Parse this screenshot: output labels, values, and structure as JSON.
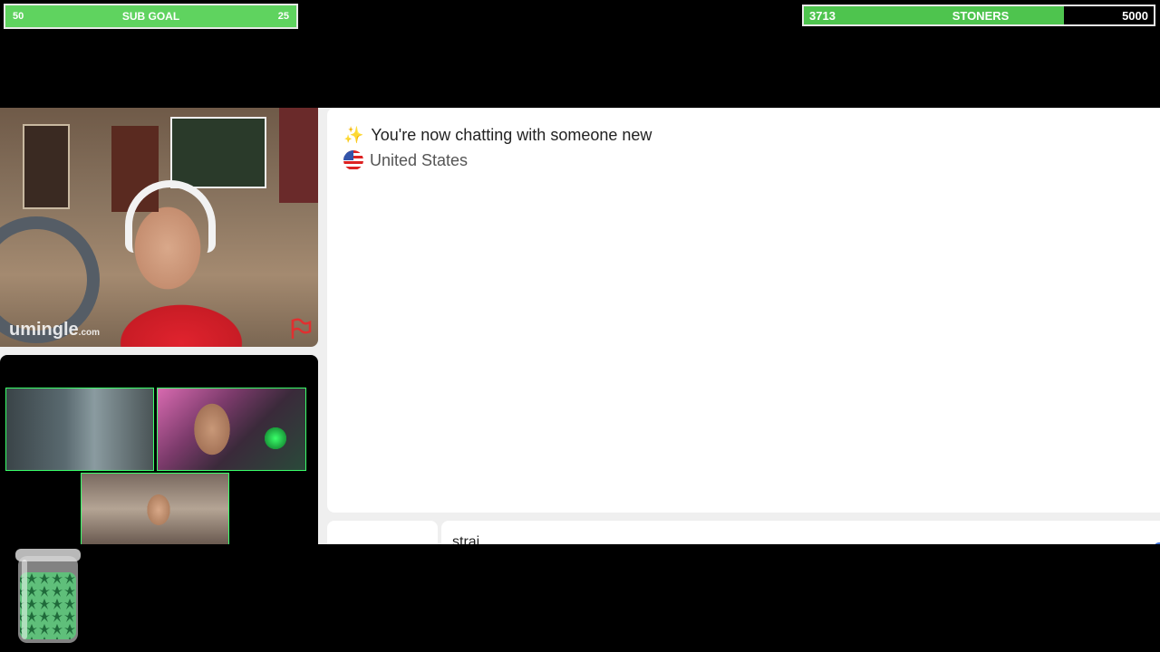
{
  "overlay": {
    "sub_goal": {
      "current": "50",
      "label": "SUB GOAL",
      "target": "25",
      "fill_fraction": 1.0,
      "color": "#5fd35f"
    },
    "stoners": {
      "current": "3713",
      "label": "STONERS",
      "target": "5000",
      "fill_fraction": 0.7426,
      "color": "#4ec44e"
    }
  },
  "video": {
    "main_logo": "umingle",
    "main_logo_suffix": ".com",
    "flag_icon": "report-flag-icon"
  },
  "chat": {
    "status_icon": "sparkles-icon",
    "status_text": "You're now chatting with someone new",
    "country_icon": "us-flag-icon",
    "country": "United States",
    "input_value": "strai",
    "accent_color": "#3b6fd6"
  }
}
